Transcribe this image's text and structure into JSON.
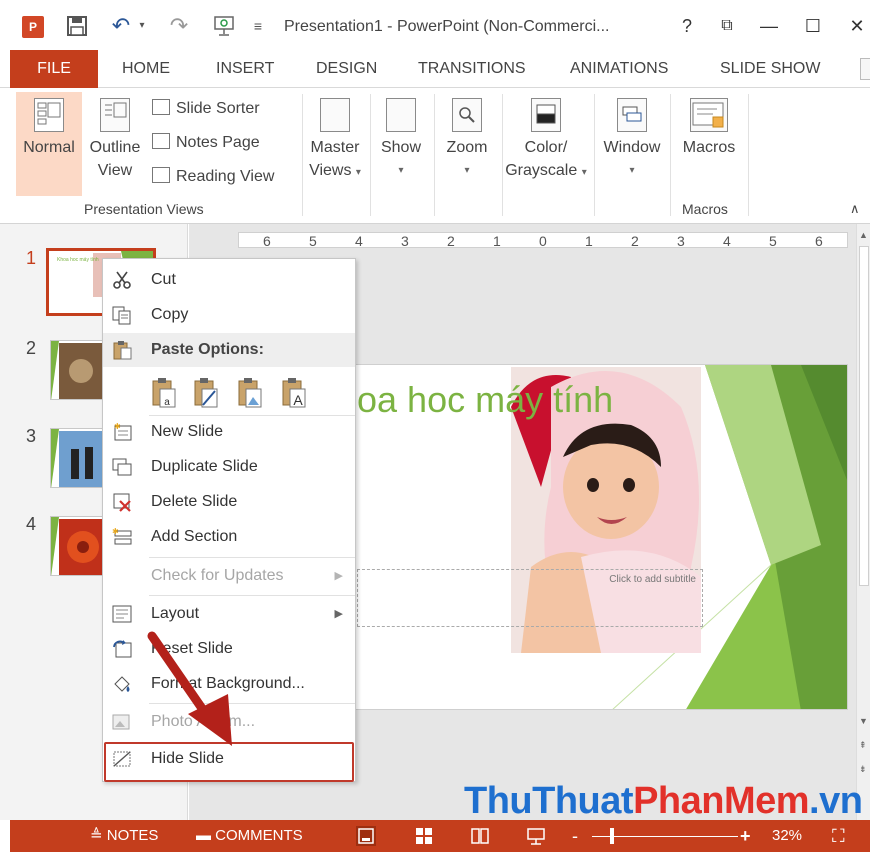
{
  "app": {
    "window_title": "Presentation1 - PowerPoint (Non-Commerci...",
    "logo_text": "P",
    "help_glyph": "?",
    "ribbon_display_glyph": "⧉",
    "minimize_glyph": "—",
    "maximize_glyph": "☐",
    "close_glyph": "✕"
  },
  "qat": {
    "save_glyph": "💾",
    "undo_glyph": "↶",
    "undo_caret": "▾",
    "redo_glyph": "↷",
    "present_glyph": "⎚",
    "customize_glyph": "≡"
  },
  "tabs": [
    {
      "label": "FILE"
    },
    {
      "label": "HOME"
    },
    {
      "label": "INSERT"
    },
    {
      "label": "DESIGN"
    },
    {
      "label": "TRANSITIONS"
    },
    {
      "label": "ANIMATIONS"
    },
    {
      "label": "SLIDE SHOW"
    }
  ],
  "ribbon": {
    "normal": "Normal",
    "outline_line1": "Outline",
    "outline_line2": "View",
    "slide_sorter": "Slide Sorter",
    "notes_page": "Notes Page",
    "reading_view": "Reading View",
    "presentation_views_group": "Presentation Views",
    "master_line1": "Master",
    "master_line2": "Views",
    "show": "Show",
    "zoom": "Zoom",
    "color_line1": "Color/",
    "color_line2": "Grayscale",
    "window": "Window",
    "macros": "Macros",
    "macros_group": "Macros",
    "collapse_glyph": "∧",
    "caret": "▾"
  },
  "thumbnails": [
    {
      "number": "1",
      "title": "Khoa hoc máy tính"
    },
    {
      "number": "2"
    },
    {
      "number": "3"
    },
    {
      "number": "4"
    }
  ],
  "ruler": [
    "6",
    "5",
    "4",
    "3",
    "2",
    "1",
    "0",
    "1",
    "2",
    "3",
    "4",
    "5",
    "6"
  ],
  "slide": {
    "title": "Khoa hoc máy tính",
    "title_visible": "oa hoc máy tính",
    "subtitle_placeholder": "Click to add subtitle"
  },
  "context_menu": {
    "cut": "Cut",
    "copy": "Copy",
    "paste_options": "Paste Options:",
    "new_slide": "New Slide",
    "duplicate_slide": "Duplicate Slide",
    "delete_slide": "Delete Slide",
    "add_section": "Add Section",
    "check_updates": "Check for Updates",
    "layout": "Layout",
    "reset_slide": "Reset Slide",
    "format_background": "Format Background...",
    "photo_album": "Photo Album...",
    "hide_slide": "Hide Slide",
    "submenu_glyph": "▶"
  },
  "watermark": {
    "part1": "ThuThuat",
    "part2": "PhanMem",
    "part3": ".vn"
  },
  "statusbar": {
    "notes": "NOTES",
    "comments": "COMMENTS",
    "notes_glyph": "≜",
    "comments_glyph": "▬",
    "zoom_minus": "-",
    "zoom_plus": "+",
    "zoom_level": "32%",
    "fit_glyph": "⛶"
  },
  "colors": {
    "accent": "#c43e1c",
    "title_green": "#7cb342",
    "highlight_red": "#c0392b"
  }
}
